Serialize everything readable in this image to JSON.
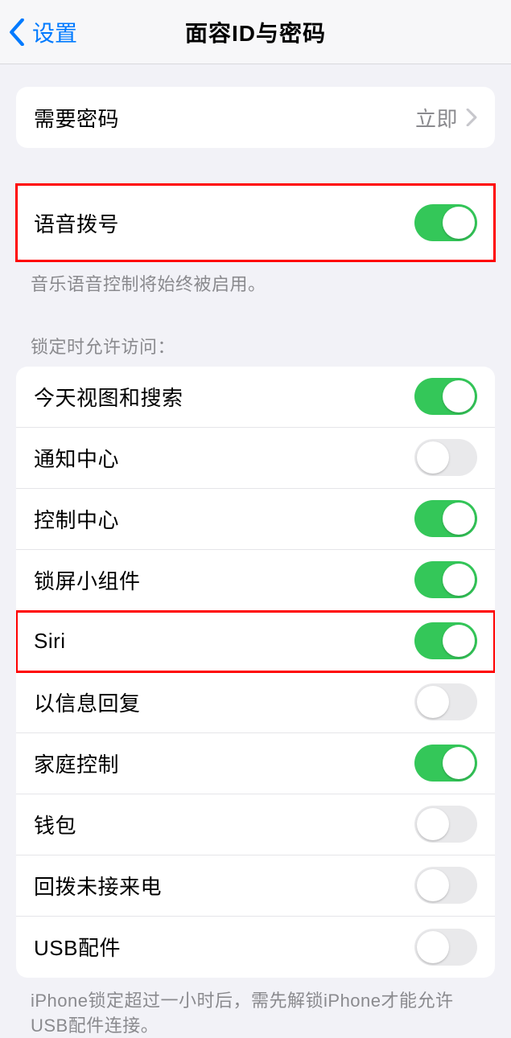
{
  "header": {
    "back_label": "设置",
    "title": "面容ID与密码"
  },
  "require_passcode": {
    "label": "需要密码",
    "value": "立即"
  },
  "voice_dial": {
    "label": "语音拨号",
    "on": true,
    "footer": "音乐语音控制将始终被启用。"
  },
  "lock_access": {
    "header": "锁定时允许访问：",
    "items": [
      {
        "label": "今天视图和搜索",
        "on": true
      },
      {
        "label": "通知中心",
        "on": false
      },
      {
        "label": "控制中心",
        "on": true
      },
      {
        "label": "锁屏小组件",
        "on": true
      },
      {
        "label": "Siri",
        "on": true,
        "highlight": true
      },
      {
        "label": "以信息回复",
        "on": false
      },
      {
        "label": "家庭控制",
        "on": true
      },
      {
        "label": "钱包",
        "on": false
      },
      {
        "label": "回拨未接来电",
        "on": false
      },
      {
        "label": "USB配件",
        "on": false
      }
    ]
  },
  "usb_footer": "iPhone锁定超过一小时后，需先解锁iPhone才能允许USB配件连接。"
}
